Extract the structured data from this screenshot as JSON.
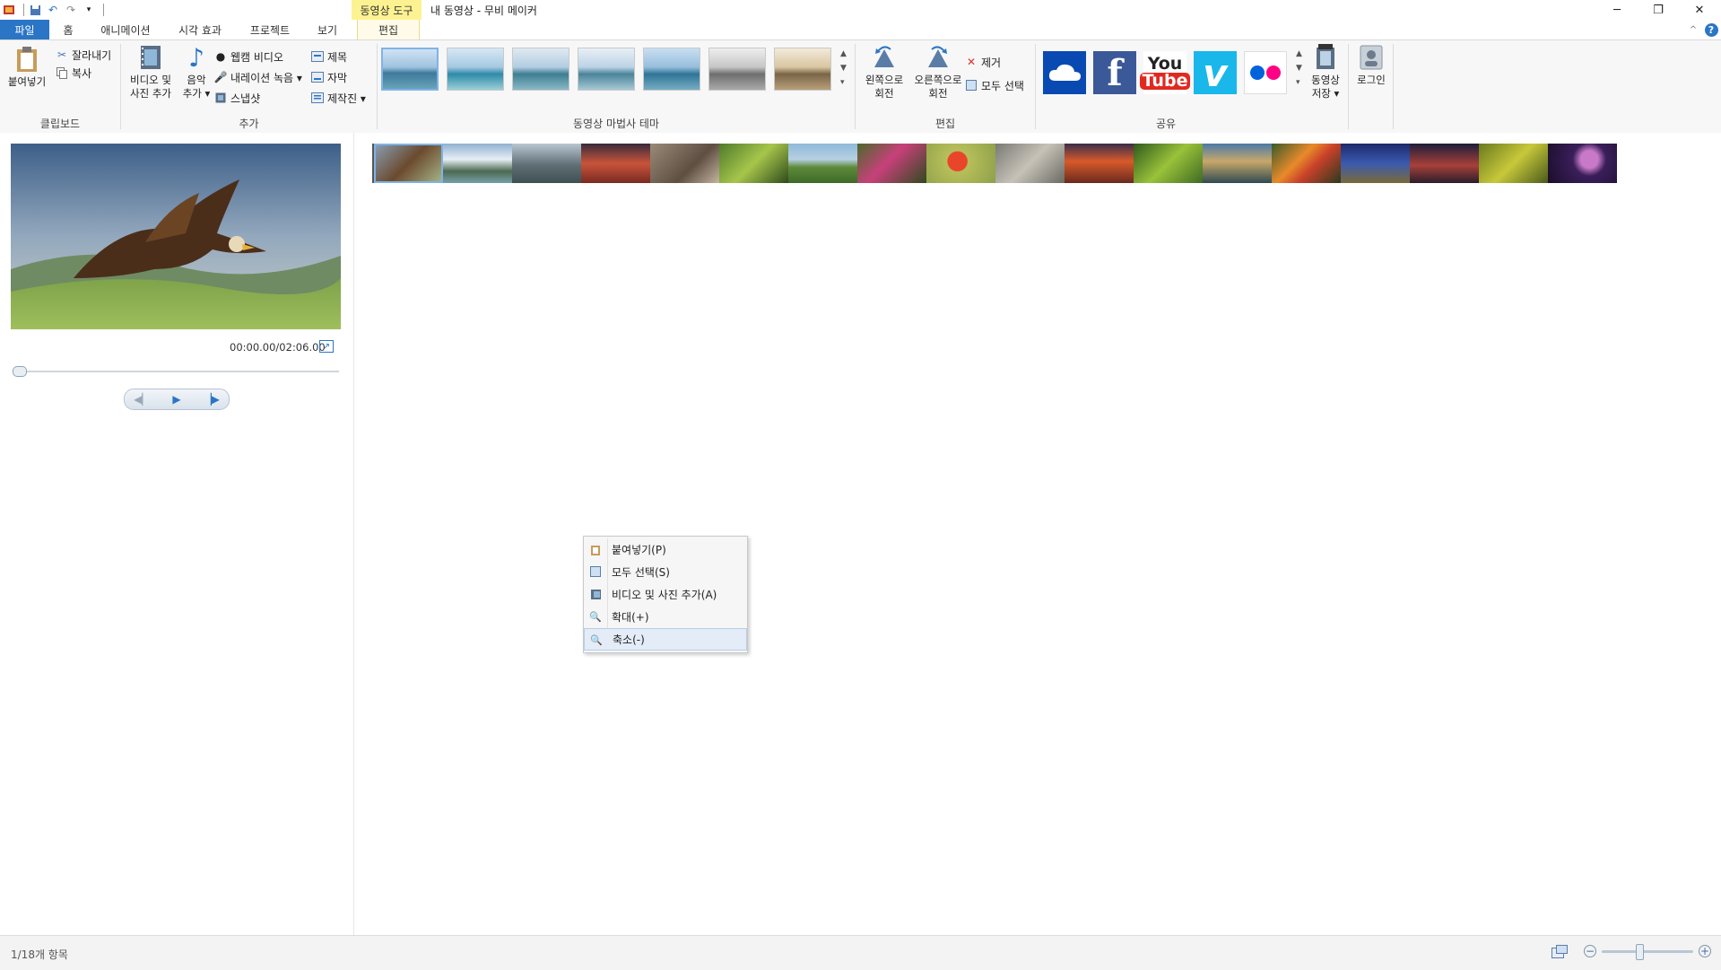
{
  "titlebar": {
    "context_tool": "동영상 도구",
    "window_title": "내 동영상 - 무비 메이커",
    "minimize": "─",
    "restore": "❐",
    "close": "✕"
  },
  "tabs": {
    "file": "파일",
    "home": "홈",
    "animation": "애니메이션",
    "visual_effects": "시각 효과",
    "project": "프로젝트",
    "view": "보기",
    "edit": "편집"
  },
  "ribbon": {
    "clipboard": {
      "label": "클립보드",
      "paste": "붙여넣기",
      "cut": "잘라내기",
      "copy": "복사"
    },
    "add": {
      "label": "추가",
      "add_video_line1": "비디오 및",
      "add_video_line2": "사진 추가",
      "music_line1": "음악",
      "music_line2": "추가 ▾",
      "webcam": "웹캠 비디오",
      "narration": "내레이션 녹음 ▾",
      "snapshot": "스냅샷",
      "title": "제목",
      "caption": "자막",
      "credits": "제작진 ▾"
    },
    "themes": {
      "label": "동영상 마법사 테마"
    },
    "editing": {
      "label": "편집",
      "rotate_left_line1": "왼쪽으로",
      "rotate_left_line2": "회전",
      "rotate_right_line1": "오른쪽으로",
      "rotate_right_line2": "회전",
      "remove": "제거",
      "select_all": "모두 선택"
    },
    "share": {
      "label": "공유",
      "youtube_line1": "You",
      "youtube_line2": "Tube",
      "facebook": "f",
      "vimeo": "v",
      "save_line1": "동영상",
      "save_line2": "저장 ▾",
      "login": "로그인"
    }
  },
  "preview": {
    "time": "00:00.00/02:06.00"
  },
  "context_menu": {
    "items": [
      {
        "label": "붙여넣기(P)"
      },
      {
        "label": "모두 선택(S)"
      },
      {
        "label": "비디오 및 사진 추가(A)"
      },
      {
        "label": "확대(+)"
      },
      {
        "label": "축소(-)"
      }
    ]
  },
  "status": {
    "text": "1/18개 항목"
  },
  "colors": {
    "accent": "#2b75c6",
    "context_tab": "#fdf291",
    "onedrive": "#094ab2",
    "facebook": "#3b5998",
    "vimeo": "#1ab7ea"
  }
}
